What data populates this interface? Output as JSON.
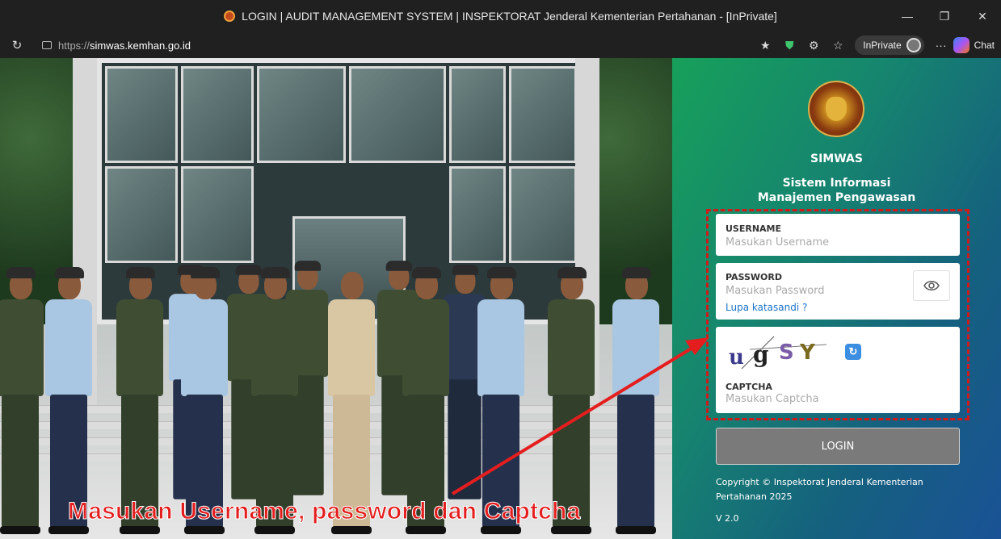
{
  "browser": {
    "title": "LOGIN | AUDIT MANAGEMENT SYSTEM | INSPEKTORAT Jenderal Kementerian Pertahanan - [InPrivate]",
    "url_scheme": "https://",
    "url_host": "simwas.kemhan.go.id",
    "inprivate_label": "InPrivate",
    "chat_label": "Chat",
    "more_label": "···",
    "minimize": "—",
    "restore": "❐",
    "close": "✕",
    "reload": "↻"
  },
  "login": {
    "app_name": "SIMWAS",
    "subtitle_line1": "Sistem Informasi",
    "subtitle_line2": "Manajemen Pengawasan",
    "username_label": "USERNAME",
    "username_placeholder": "Masukan Username",
    "password_label": "PASSWORD",
    "password_placeholder": "Masukan Password",
    "forgot_password": "Lupa katasandi ?",
    "captcha_text": "ugSY",
    "captcha_label": "CAPTCHA",
    "captcha_placeholder": "Masukan Captcha",
    "login_button": "LOGIN",
    "copyright": "Copyright © Inspektorat Jenderal Kementerian Pertahanan 2025",
    "version": "V 2.0"
  },
  "annotation": {
    "caption": "Masukan Username, password dan Captcha",
    "highlight_color": "#d01a1a"
  },
  "colors": {
    "panel_gradient_start": "#17a05a",
    "panel_gradient_end": "#1a5296",
    "login_button": "#7a7a7a",
    "link": "#1a73c9"
  }
}
